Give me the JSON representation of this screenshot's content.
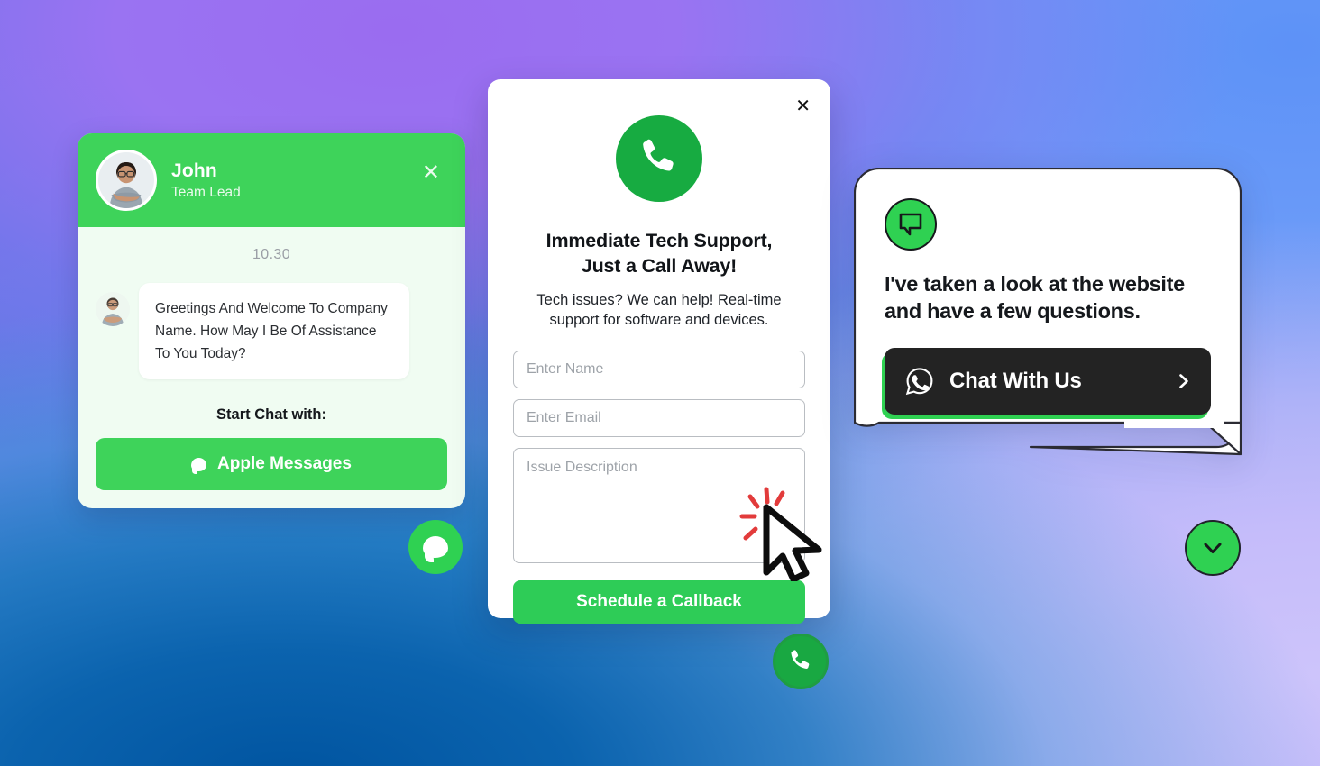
{
  "background": {
    "colors": [
      "#6f6ce6",
      "#9a6cf0",
      "#5d92f7",
      "#0054a0",
      "#cdc4fb"
    ]
  },
  "theme": {
    "green": "#3ed35a",
    "green_dark": "#17ab41",
    "green_bright": "#2fd152",
    "dark": "#232323"
  },
  "chat_card": {
    "name": "John",
    "role": "Team Lead",
    "close_label": "✕",
    "timestamp": "10.30",
    "message": "Greetings And Welcome To Company Name. How May I Be Of Assistance To You Today?",
    "start_chat_label": "Start Chat with:",
    "channel_button": "Apple Messages",
    "avatar_icon": "user-photo-avatar"
  },
  "callback_modal": {
    "close_label": "✕",
    "badge_icon": "phone-icon",
    "title": "Immediate Tech Support, Just a Call Away!",
    "title_line1": "Immediate Tech Support,",
    "title_line2": "Just a Call Away!",
    "subtitle": "Tech issues? We can help! Real-time support for software and devices.",
    "fields": {
      "name_placeholder": "Enter Name",
      "name_value": "",
      "email_placeholder": "Enter Email",
      "email_value": "",
      "issue_placeholder": "Issue Description",
      "issue_value": ""
    },
    "submit_label": "Schedule a Callback"
  },
  "speech_bubble": {
    "avatar_icon": "chat-bubble-icon",
    "text": "I've taken a look at the website and have a few questions.",
    "text_line1": "I've taken a look at the website",
    "text_line2": "and have a few questions.",
    "cta_label": "Chat With Us",
    "cta_icon": "whatsapp-icon",
    "cta_chevron": "chevron-right-icon"
  },
  "fabs": [
    {
      "name": "apple-messages-fab",
      "icon": "message-bubble-icon",
      "color": "#2fd152"
    },
    {
      "name": "phone-call-fab",
      "icon": "phone-icon",
      "color": "#19a842"
    },
    {
      "name": "collapse-widget-fab",
      "icon": "chevron-down-icon",
      "color": "#2fd152"
    }
  ],
  "cursor": {
    "icon": "arrow-cursor-click",
    "state": "clicking"
  }
}
